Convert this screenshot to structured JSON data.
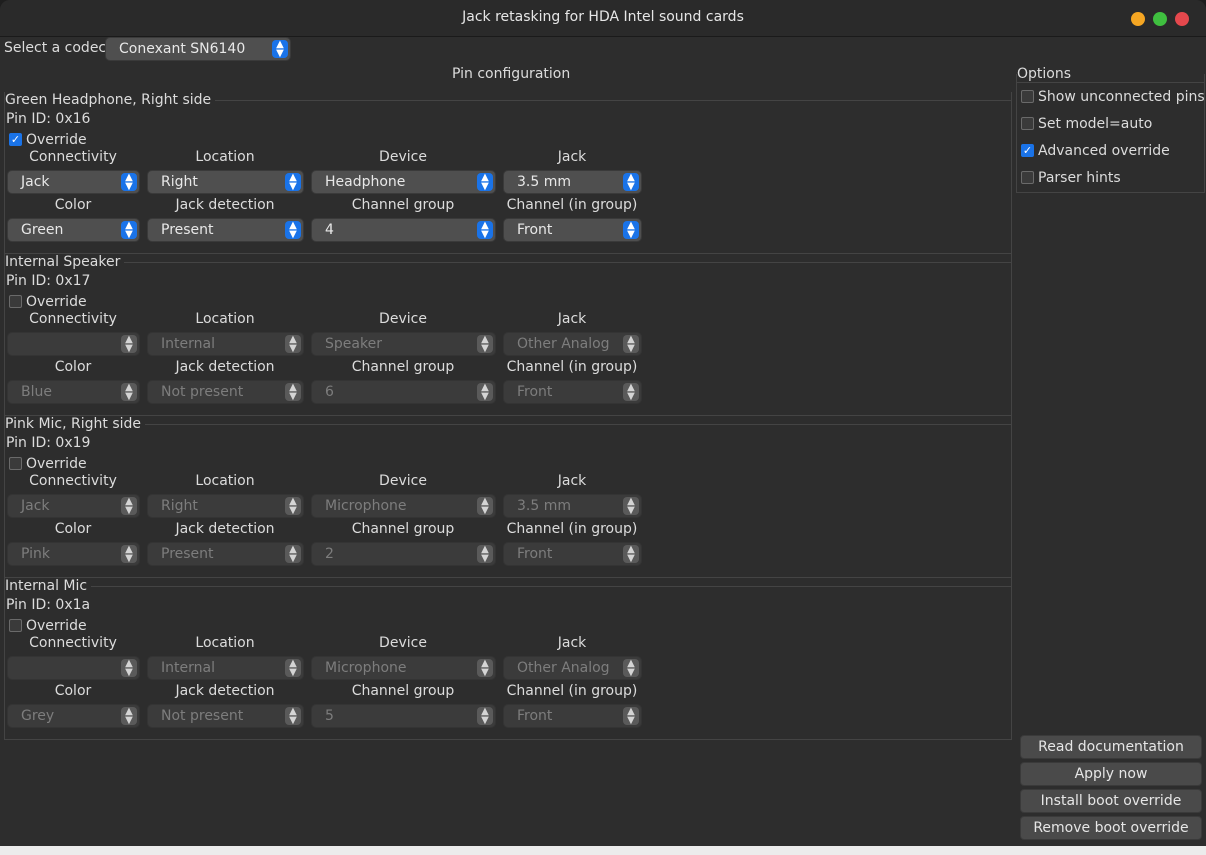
{
  "window": {
    "title": "Jack retasking for HDA Intel sound cards"
  },
  "codec": {
    "label": "Select a codec:",
    "value": "Conexant SN6140"
  },
  "pin_config": {
    "title": "Pin configuration",
    "field_labels": [
      "Connectivity",
      "Location",
      "Device",
      "Jack",
      "Color",
      "Jack detection",
      "Channel group",
      "Channel (in group)"
    ],
    "groups": [
      {
        "title": "Green Headphone, Right side",
        "pin_id": "Pin ID: 0x16",
        "override_label": "Override",
        "override": true,
        "values": [
          "Jack",
          "Right",
          "Headphone",
          "3.5 mm",
          "Green",
          "Present",
          "4",
          "Front"
        ]
      },
      {
        "title": "Internal Speaker",
        "pin_id": "Pin ID: 0x17",
        "override_label": "Override",
        "override": false,
        "values": [
          "",
          "Internal",
          "Speaker",
          "Other Analog",
          "Blue",
          "Not present",
          "6",
          "Front"
        ]
      },
      {
        "title": "Pink Mic, Right side",
        "pin_id": "Pin ID: 0x19",
        "override_label": "Override",
        "override": false,
        "values": [
          "Jack",
          "Right",
          "Microphone",
          "3.5 mm",
          "Pink",
          "Present",
          "2",
          "Front"
        ]
      },
      {
        "title": "Internal Mic",
        "pin_id": "Pin ID: 0x1a",
        "override_label": "Override",
        "override": false,
        "values": [
          "",
          "Internal",
          "Microphone",
          "Other Analog",
          "Grey",
          "Not present",
          "5",
          "Front"
        ]
      }
    ]
  },
  "options": {
    "title": "Options",
    "items": [
      {
        "label": "Show unconnected pins",
        "checked": false
      },
      {
        "label": "Set model=auto",
        "checked": false
      },
      {
        "label": "Advanced override",
        "checked": true
      },
      {
        "label": "Parser hints",
        "checked": false
      }
    ]
  },
  "actions": [
    "Read documentation",
    "Apply now",
    "Install boot override",
    "Remove boot override"
  ],
  "colors": {
    "accent": "#1a73e8",
    "window_bg": "#2d2d2d",
    "close": "#e5484d",
    "minimize": "#f5a623",
    "maximize": "#3fbf3f"
  },
  "icons": {
    "checkbox_check": "check-icon",
    "combo_arrow": "updown-chevron-icon"
  }
}
